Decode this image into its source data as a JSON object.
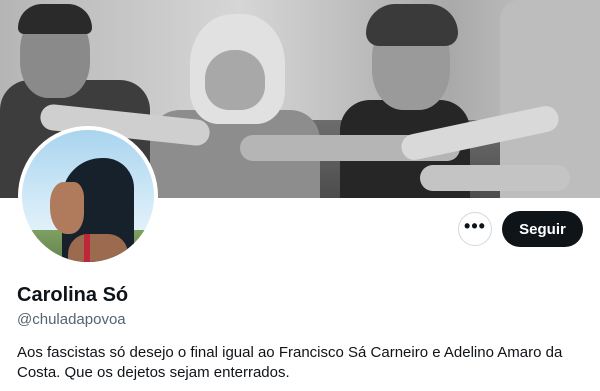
{
  "profile": {
    "display_name": "Carolina Só",
    "handle": "@chuladapovoa",
    "bio": "Aos fascistas só desejo o final igual ao Francisco Sá Carneiro e Adelino Amaro da Costa. Que os dejetos sejam enterrados."
  },
  "actions": {
    "more_icon": "more-horizontal-icon",
    "more_label": "•••",
    "follow_label": "Seguir"
  },
  "colors": {
    "follow_button_bg": "#0f1419",
    "handle_text": "#536471",
    "border": "#cfd9de"
  }
}
